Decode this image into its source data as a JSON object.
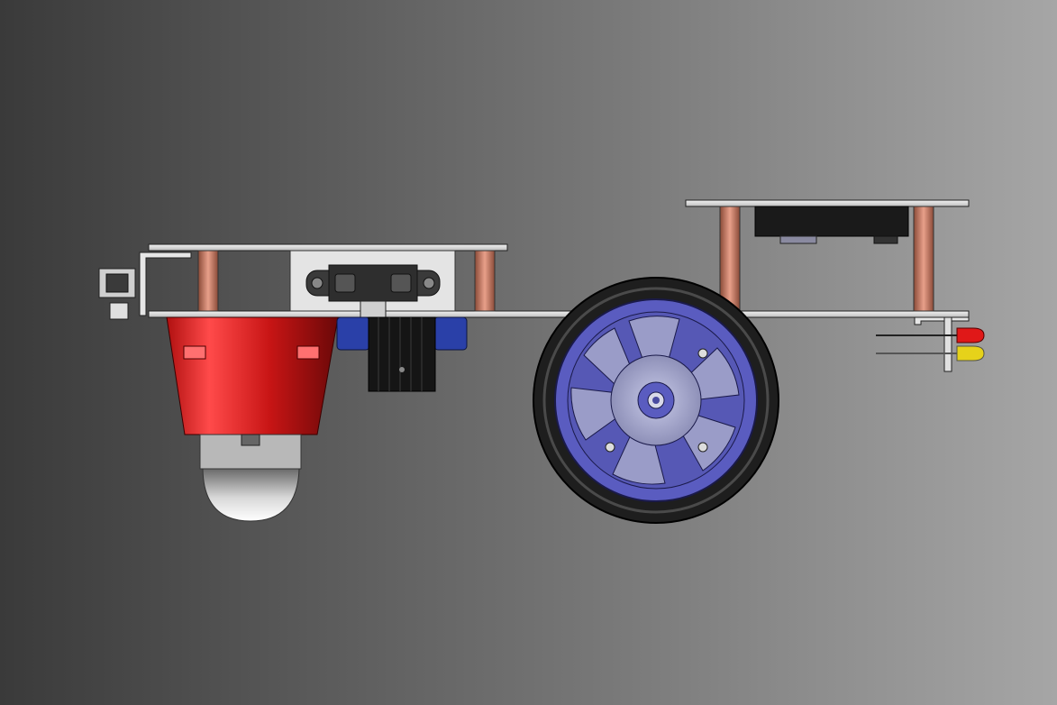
{
  "scene": {
    "subject": "robot",
    "view": "side",
    "background": {
      "left": "#3a3a3a",
      "right": "#a6a6a6"
    }
  },
  "parts": {
    "chassis": {
      "color": "#dcdcdc",
      "edge": "#2a2a2a"
    },
    "standoffs": {
      "color": "#d9826a"
    },
    "ball_caster_housing": {
      "color": "#d42020"
    },
    "ball_caster_wheel": {
      "color": "#c8c8c8"
    },
    "distance_sensor": {
      "color": "#2e2e2e"
    },
    "servo_mounts": {
      "color": "#2a40a8"
    },
    "heatsink": {
      "color": "#151515"
    },
    "drive_wheel_hub": {
      "color": "#5a5cc0"
    },
    "drive_wheel_tire": {
      "color": "#1e1e1e"
    },
    "controller_board": {
      "color": "#1a1a1a"
    },
    "led_red": {
      "color": "#e01818"
    },
    "led_yellow": {
      "color": "#e6d21a"
    }
  }
}
